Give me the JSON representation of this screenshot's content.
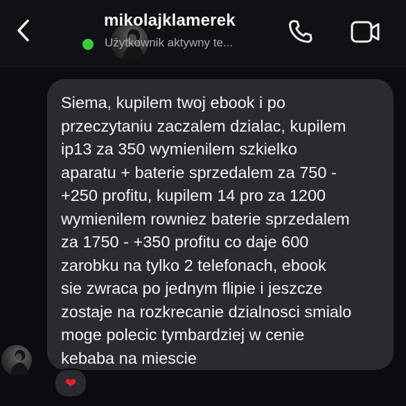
{
  "header": {
    "username": "mikolajklamerek",
    "status": "Użytkownik aktywny te...",
    "icons": {
      "back": "chevron-left-icon",
      "call": "phone-icon",
      "video": "video-camera-icon"
    },
    "online_color": "#3ec93e"
  },
  "message": {
    "text": "Siema, kupilem twoj ebook i po\nprzeczytaniu zaczalem dzialac, kupilem\nip13 za 350 wymienilem szkielko\naparatu + baterie  sprzedalem za 750 -\n+250 profitu, kupilem 14 pro za 1200\nwymienilem rowniez baterie sprzedalem\nza 1750 - +350 profitu co daje 600\nzarobku na tylko 2 telefonach, ebook\nsie zwraca po jednym flipie i jeszcze\nzostaje na rozkrecanie dzialnosci smialo\nmoge polecic tymbardziej w cenie\nkebaba na miescie",
    "reaction": "❤",
    "reaction_color": "#e8202e",
    "bubble_color": "#2a2b30"
  }
}
